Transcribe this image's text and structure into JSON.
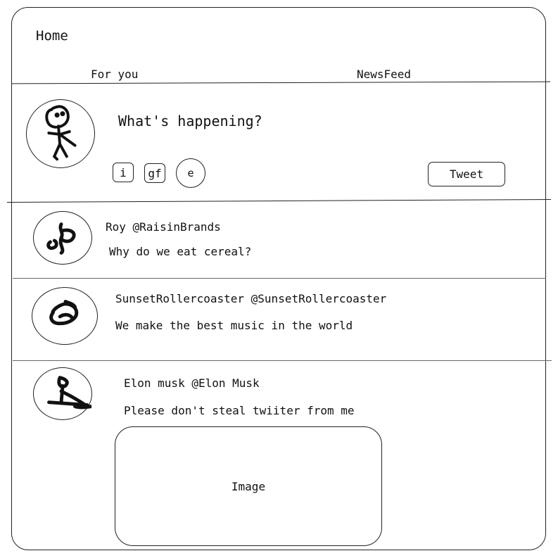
{
  "header": {
    "title": "Home"
  },
  "tabs": [
    {
      "label": "For you"
    },
    {
      "label": "NewsFeed"
    }
  ],
  "composer": {
    "prompt": "What's happening?",
    "tools": [
      {
        "label": "i"
      },
      {
        "label": "gf"
      },
      {
        "label": "e"
      }
    ],
    "tweet_label": "Tweet",
    "avatar_icon": "stick-figure-icon"
  },
  "feed": [
    {
      "handle": "Roy @RaisinBrands",
      "text": "Why do we eat cereal?",
      "avatar_icon": "scribble-avatar-icon"
    },
    {
      "handle": "SunsetRollercoaster @SunsetRollercoaster",
      "text": "We make the best music in the world",
      "avatar_icon": "scribble-avatar-icon"
    },
    {
      "handle": "Elon musk @Elon Musk",
      "text": "Please don't steal twiiter from me",
      "image_label": "Image",
      "avatar_icon": "scribble-avatar-icon"
    }
  ]
}
